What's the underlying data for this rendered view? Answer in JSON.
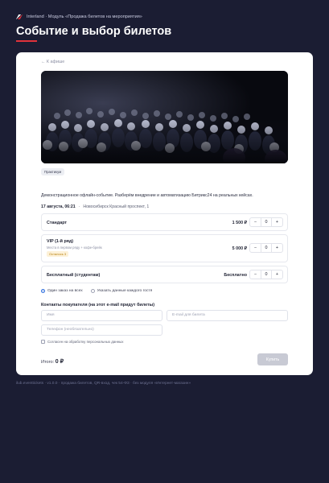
{
  "header": {
    "breadcrumb": "Interland · Модуль «Продажа билетов на мероприятия»",
    "title": "Событие и выбор билетов",
    "accent_color": "#e0323b"
  },
  "card": {
    "back_link": "← К афише",
    "tag": "Практикум",
    "description": "Демонстрационное офлайн-событие. Разберём внедрение и автоматизацию Битрикс24 на реальных кейсах.",
    "date": "17 августа, 06:21",
    "separator": "·",
    "location": "Новосибирск Красный проспект, 1"
  },
  "tickets": [
    {
      "name": "Стандарт",
      "price": "1 500 ₽",
      "qty": "0",
      "minus": "−",
      "plus": "+"
    },
    {
      "name": "VIP (1-й ряд)",
      "subtitle": "Места в первом ряду + кофе-брейк",
      "badge": "Осталось 3",
      "price": "5 000 ₽",
      "qty": "0",
      "minus": "−",
      "plus": "+"
    },
    {
      "name": "Бесплатный (студентам)",
      "price": "Бесплатно",
      "qty": "0",
      "minus": "−",
      "plus": "+"
    }
  ],
  "order_mode": {
    "options": [
      "Один заказ на всех",
      "Указать данные каждого гостя"
    ],
    "selected": "Один заказ на всех"
  },
  "contacts": {
    "title": "Контакты покупателя (на этот e-mail придут билеты)",
    "name_placeholder": "Имя",
    "email_placeholder": "E-mail для билета",
    "phone_placeholder": "Телефон (необязательно)",
    "consent": "Согласен на обработку персональных данных"
  },
  "summary": {
    "total_label": "Итого:",
    "total_value": "0 ₽",
    "buy_label": "Купить"
  },
  "footer": {
    "text": "ilub.eventtickets · v1.0.0 · продажа билетов, QR-вход, чек 54-ФЗ · без модуля «Интернет-магазин»"
  },
  "icons": {
    "logo": "interland-logo-icon",
    "hero": "audience-photo"
  }
}
